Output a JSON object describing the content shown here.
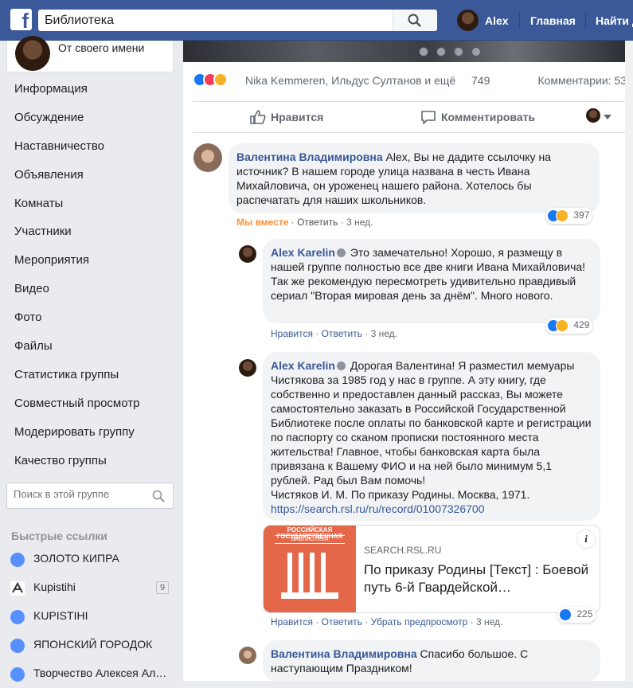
{
  "topbar": {
    "logo": "f",
    "search_value": "Библиотека",
    "user_name": "Alex",
    "home_label": "Главная",
    "find_label": "Найти д"
  },
  "left": {
    "identity_label": "От своего имени",
    "nav": [
      "Информация",
      "Обсуждение",
      "Наставничество",
      "Объявления",
      "Комнаты",
      "Участники",
      "Мероприятия",
      "Видео",
      "Фото",
      "Файлы",
      "Статистика группы",
      "Совместный просмотр",
      "Модерировать группу",
      "Качество группы"
    ],
    "group_search_placeholder": "Поиск в этой группе",
    "quick_links_title": "Быстрые ссылки",
    "quick_links": [
      {
        "label": "ЗОЛОТО КИПРА",
        "badge": ""
      },
      {
        "label": "Kupistihi",
        "badge": "9"
      },
      {
        "label": "KUPISTIHI",
        "badge": ""
      },
      {
        "label": "ЯПОНСКИЙ ГОРОДОК",
        "badge": ""
      },
      {
        "label": "Творчество Алексея Алексеевича",
        "badge": ""
      }
    ]
  },
  "post": {
    "reaction_names": "Nika Kemmeren, Ильдус Султанов и ещё",
    "reaction_count": "749",
    "comments_count": "Комментарии: 53",
    "like_label": "Нравится",
    "comment_label": "Комментировать"
  },
  "comments": [
    {
      "author": "Валентина Владимировна",
      "text": " Alex, Вы не дадите ссылочку на источник? В нашем городе улица названа в честь Ивана Михайловича, он уроженец нашего района. Хотелось бы распечатать для наших школьников.",
      "meta_a": "Мы вместе",
      "reply": "Ответить",
      "time": "3 нед.",
      "reactions": "397"
    },
    {
      "author": "Alex Karelin",
      "text": " Это замечательно! Хорошо, я размещу в нашей группе полностью все две книги Ивана Михайловича! Так же рекомендую пересмотреть удивительно правдивый сериал \"Вторая мировая день за днём\". Много нового.",
      "like": "Нравится",
      "reply": "Ответить",
      "time": "3 нед.",
      "reactions": "429"
    },
    {
      "author": "Alex Karelin",
      "text": " Дорогая Валентина! Я разместил мемуары Чистякова за 1985 год у нас в группе. А эту книгу, где собственно и предоставлен данный рассказ, Вы можете самостоятельно заказать в Российской Государственной Библиотеке после оплаты по банковской карте и регистрации по паспорту со сканом прописки постоянного места жительства! Главное, чтобы банковская карта была привязана к Вашему ФИО и на ней было минимум 5,1 рублей. Рад был Вам помочь!",
      "text2": "Чистяков И. М. По приказу Родины. Москва, 1971.",
      "link": "https://search.rsl.ru/ru/record/01007326700",
      "preview": {
        "logo_line1": "РОССИЙСКАЯ ГОСУДАРСТВЕННАЯ",
        "logo_line2": "БИБЛИОТЕКА",
        "domain": "SEARCH.RSL.RU",
        "title": "По приказу Родины [Текст] : Боевой путь 6-й Гвардейской…",
        "info": "i"
      },
      "like": "Нравится",
      "reply": "Ответить",
      "preview_hide": "Убрать предпросмотр",
      "time": "3 нед.",
      "reactions": "225"
    },
    {
      "author": "Валентина Владимировна",
      "text": " Спасибо большое. С наступающим Праздником!"
    }
  ],
  "colors": {
    "topbar": "#3b5998",
    "link": "#385898",
    "accent_orange": "#f7923b"
  }
}
